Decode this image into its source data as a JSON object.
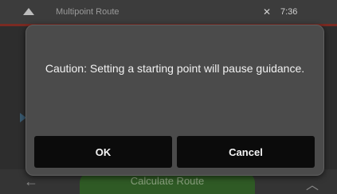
{
  "app": {
    "title": "Multipoint Route",
    "clock": "7:36",
    "gps_icon": "satellite-icon",
    "bottom_button": "Calculate Route",
    "back_icon": "back-arrow-icon",
    "expand_icon": "chevron-up-icon"
  },
  "dialog": {
    "message": "Caution: Setting a starting point will pause guidance.",
    "ok_label": "OK",
    "cancel_label": "Cancel"
  },
  "colors": {
    "dialog_bg": "#4b4b4b",
    "button_bg": "#0b0b0b",
    "route_button": "#2f5a25",
    "accent": "#7a2a22"
  }
}
